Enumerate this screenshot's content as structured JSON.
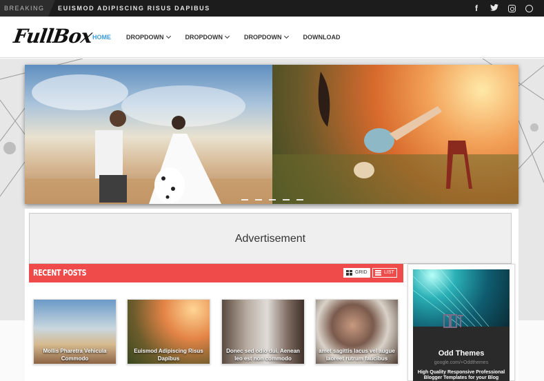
{
  "topbar": {
    "breaking_label": "BREAKING",
    "ticker_text": "EUISMOD ADIPISCING RISUS DAPIBUS",
    "social_icons": [
      "facebook-icon",
      "twitter-icon",
      "instagram-icon",
      "dribbble-icon"
    ]
  },
  "header": {
    "logo_text": "FullBox",
    "nav": [
      {
        "label": "HOME",
        "active": true
      },
      {
        "label": "DROPDOWN",
        "dropdown": true
      },
      {
        "label": "DROPDOWN",
        "dropdown": true
      },
      {
        "label": "DROPDOWN",
        "dropdown": true
      },
      {
        "label": "DOWNLOAD"
      }
    ]
  },
  "slider": {
    "slide_count": 5
  },
  "ad": {
    "label": "Advertisement"
  },
  "recent_posts": {
    "title": "RECENT POSTS",
    "grid_label": "GRID",
    "list_label": "LIST",
    "posts": [
      {
        "caption": "Mollis Pharetra Vehicula Commodo"
      },
      {
        "caption": "Euismod Adipiscing Risus Dapibus"
      },
      {
        "caption": "Donec sed odio dui. Aenean leo est non commodo"
      },
      {
        "caption": "amet sagittis lacus vel augue laoreet rutrum faucibus"
      }
    ]
  },
  "widget": {
    "name": "Odd Themes",
    "url": "google.com/+Oddthemes",
    "tagline": "High Quality Responsive Professional Blogger Templates for your Blog"
  },
  "colors": {
    "accent_red": "#ef4b4b",
    "nav_active": "#3a9bd8",
    "topbar_bg": "#1c1c1c"
  }
}
